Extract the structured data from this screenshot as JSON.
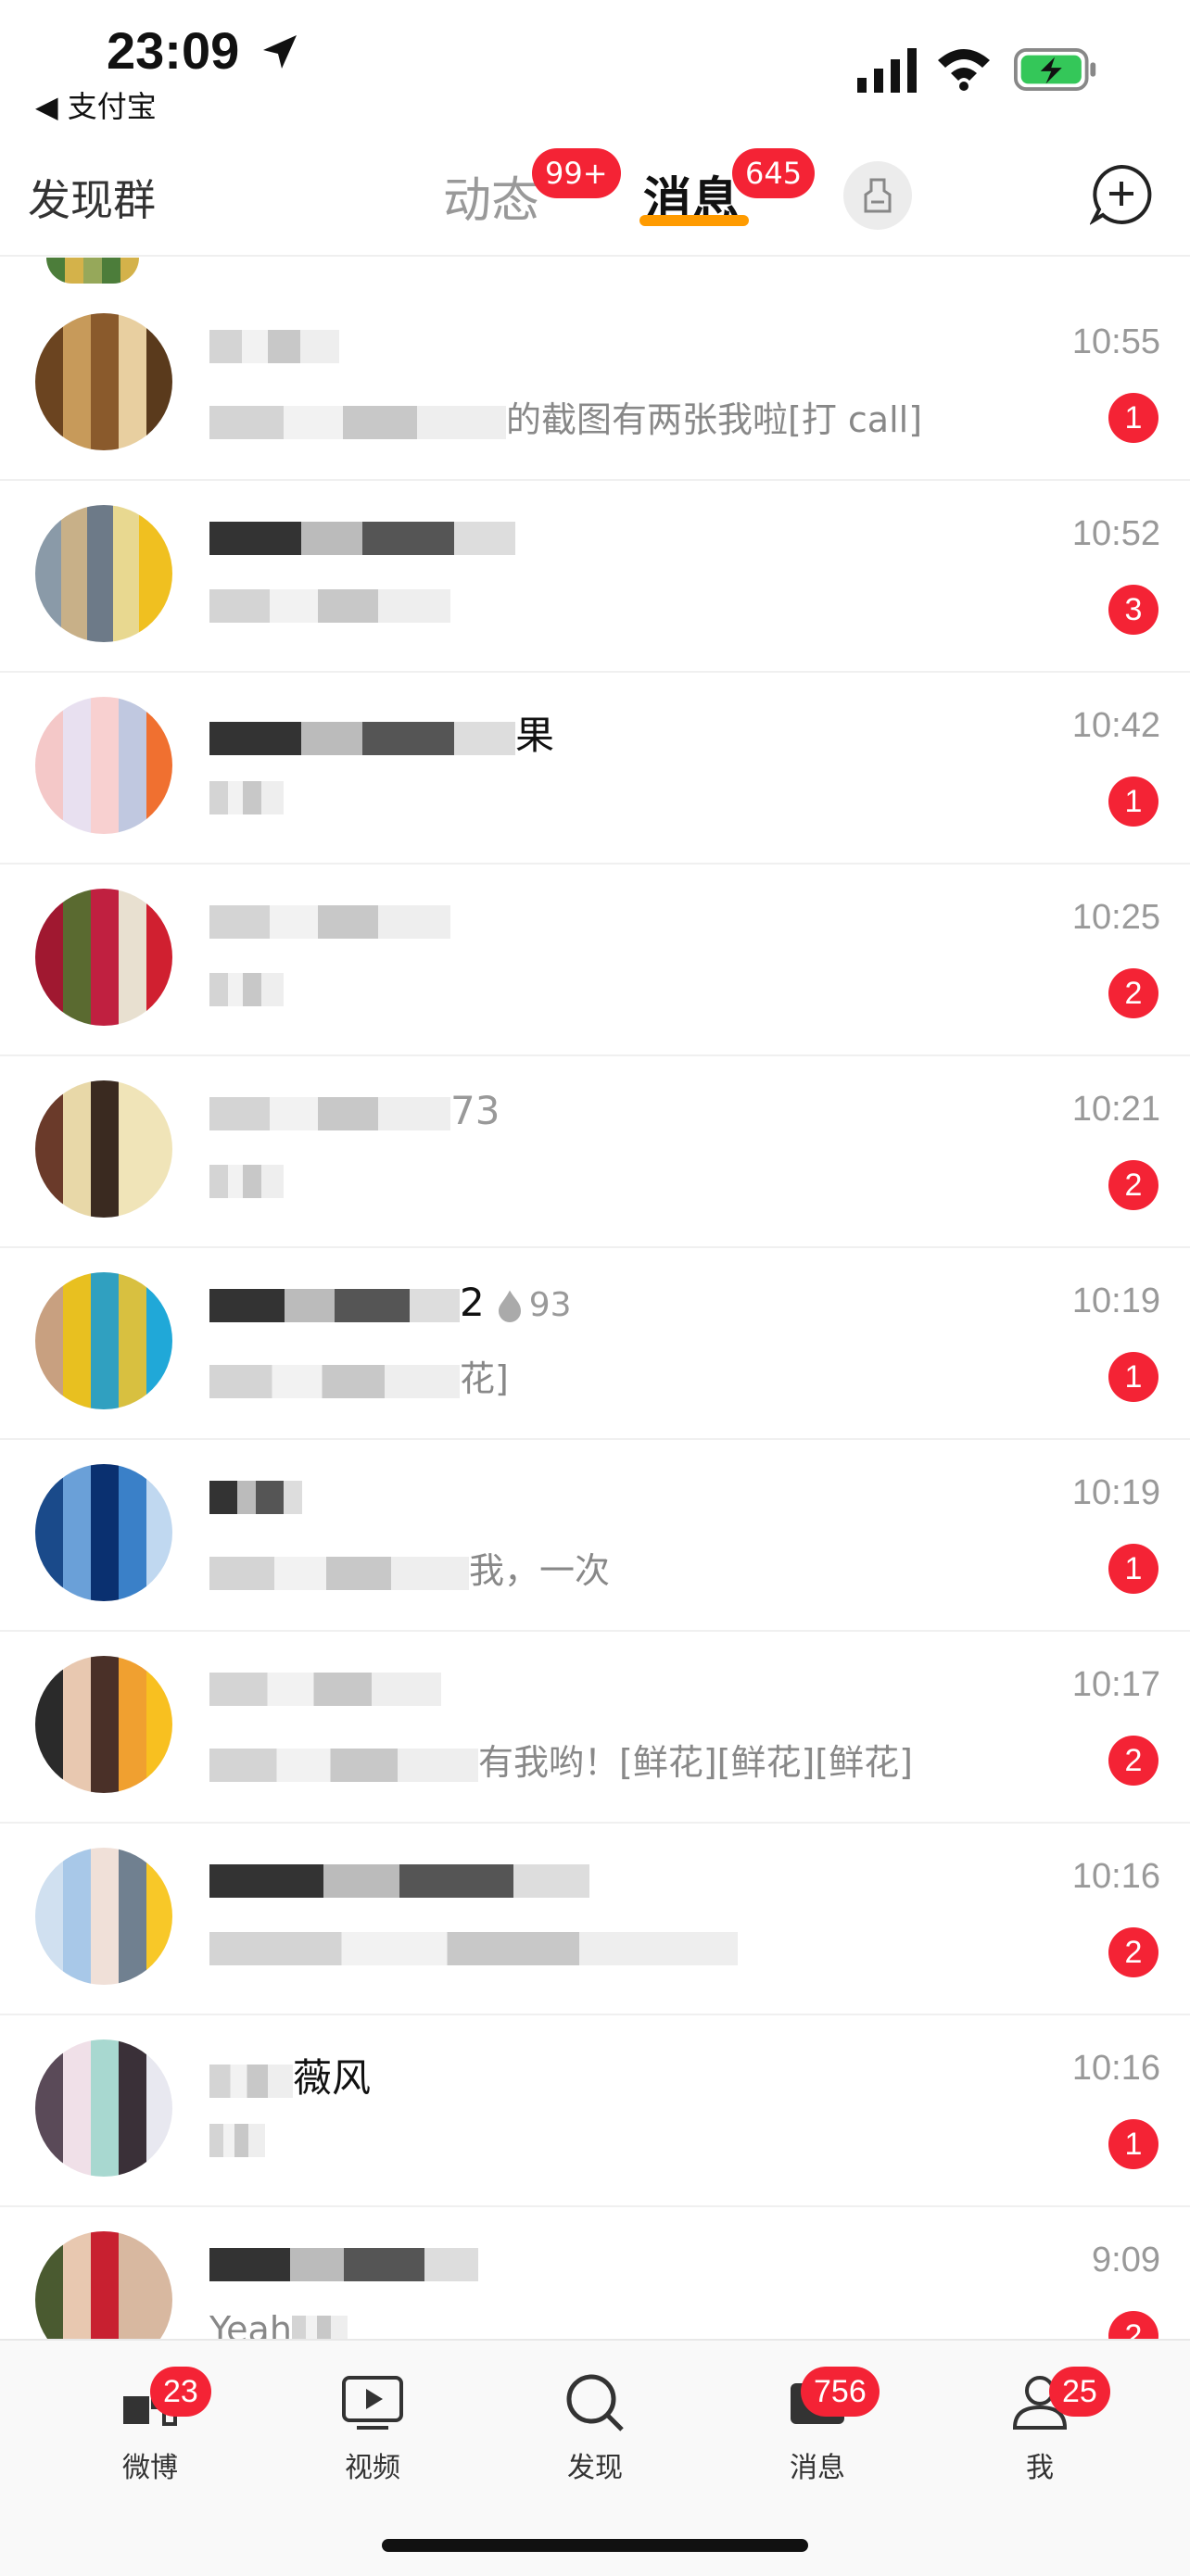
{
  "status_bar": {
    "time": "23:09",
    "back_app": "◀ 支付宝"
  },
  "top_nav": {
    "find_group": "发现群",
    "tabs": [
      {
        "label": "动态",
        "badge": "99+"
      },
      {
        "label": "消息",
        "badge": "645"
      }
    ]
  },
  "messages": [
    {
      "time": "10:55",
      "name_visible": "",
      "preview_visible": "的截图有两张我啦[打 call]",
      "count": "1"
    },
    {
      "time": "10:52",
      "name_visible": "",
      "preview_visible": "",
      "count": "3"
    },
    {
      "time": "10:42",
      "name_visible": "果",
      "preview_visible": "",
      "count": "1"
    },
    {
      "time": "10:25",
      "name_visible": "",
      "preview_visible": "",
      "count": "2"
    },
    {
      "time": "10:21",
      "name_visible": "73",
      "preview_visible": "",
      "count": "2"
    },
    {
      "time": "10:19",
      "name_visible": "2",
      "fire_value": "93",
      "preview_visible": "花]",
      "count": "1"
    },
    {
      "time": "10:19",
      "name_visible": "",
      "preview_visible": "我，一次",
      "count": "1"
    },
    {
      "time": "10:17",
      "name_visible": "",
      "preview_visible": "有我哟！[鲜花][鲜花][鲜花]",
      "count": "2"
    },
    {
      "time": "10:16",
      "name_visible": "",
      "preview_visible": "",
      "count": "2"
    },
    {
      "time": "10:16",
      "name_visible": "薇风",
      "preview_visible": "",
      "count": "1"
    },
    {
      "time": "9:09",
      "name_visible": "",
      "preview_visible": "Yeah",
      "count": "2"
    }
  ],
  "tab_bar": [
    {
      "label": "微博",
      "badge": "23",
      "icon": "weibo-home-icon"
    },
    {
      "label": "视频",
      "badge": "",
      "icon": "video-play-icon"
    },
    {
      "label": "发现",
      "badge": "",
      "icon": "search-icon"
    },
    {
      "label": "消息",
      "badge": "756",
      "icon": "message-envelope-icon"
    },
    {
      "label": "我",
      "badge": "25",
      "icon": "person-icon"
    }
  ],
  "colors": {
    "badge_red": "#f42335",
    "tab_underline": "#ff9b00",
    "battery_green": "#34c759"
  }
}
